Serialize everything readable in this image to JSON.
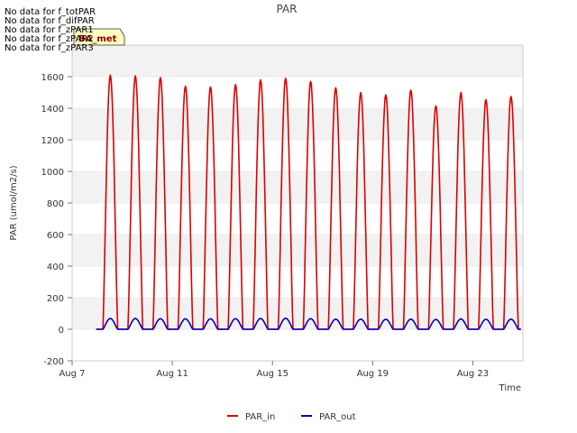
{
  "chart_data": {
    "type": "line",
    "title": "PAR",
    "xlabel": "Time",
    "ylabel": "PAR (umol/m2/s)",
    "xlim_days": [
      7,
      25
    ],
    "ylim": [
      -200,
      1800
    ],
    "yticks": [
      -200,
      0,
      200,
      400,
      600,
      800,
      1000,
      1200,
      1400,
      1600
    ],
    "xticks": [
      {
        "day": 7,
        "label": "Aug 7"
      },
      {
        "day": 11,
        "label": "Aug 11"
      },
      {
        "day": 15,
        "label": "Aug 15"
      },
      {
        "day": 19,
        "label": "Aug 19"
      },
      {
        "day": 23,
        "label": "Aug 23"
      }
    ],
    "grid": "horizontal bands",
    "legend_position": "bottom-center",
    "no_data_messages": [
      "No data for f_totPAR",
      "No data for f_difPAR",
      "No data for f_zPAR1",
      "No data for f_zPAR2",
      "No data for f_zPAR3"
    ],
    "badge": "BA_met",
    "series": [
      {
        "name": "PAR_in",
        "color": "#dd0000",
        "daily_peaks": [
          {
            "date": "Aug 8",
            "peak": 1610
          },
          {
            "date": "Aug 9",
            "peak": 1605
          },
          {
            "date": "Aug 10",
            "peak": 1595
          },
          {
            "date": "Aug 11",
            "peak": 1540
          },
          {
            "date": "Aug 12",
            "peak": 1535
          },
          {
            "date": "Aug 13",
            "peak": 1550
          },
          {
            "date": "Aug 14",
            "peak": 1580
          },
          {
            "date": "Aug 15",
            "peak": 1590
          },
          {
            "date": "Aug 16",
            "peak": 1570
          },
          {
            "date": "Aug 17",
            "peak": 1530
          },
          {
            "date": "Aug 18",
            "peak": 1500
          },
          {
            "date": "Aug 19",
            "peak": 1485
          },
          {
            "date": "Aug 20",
            "peak": 1515
          },
          {
            "date": "Aug 21",
            "peak": 1415
          },
          {
            "date": "Aug 22",
            "peak": 1500
          },
          {
            "date": "Aug 23",
            "peak": 1455
          },
          {
            "date": "Aug 24",
            "peak": 1475
          }
        ]
      },
      {
        "name": "PAR_out",
        "color": "#0000cc",
        "daily_peaks": [
          {
            "date": "Aug 8",
            "peak": 68
          },
          {
            "date": "Aug 9",
            "peak": 68
          },
          {
            "date": "Aug 10",
            "peak": 67
          },
          {
            "date": "Aug 11",
            "peak": 66
          },
          {
            "date": "Aug 12",
            "peak": 66
          },
          {
            "date": "Aug 13",
            "peak": 67
          },
          {
            "date": "Aug 14",
            "peak": 68
          },
          {
            "date": "Aug 15",
            "peak": 70
          },
          {
            "date": "Aug 16",
            "peak": 67
          },
          {
            "date": "Aug 17",
            "peak": 64
          },
          {
            "date": "Aug 18",
            "peak": 64
          },
          {
            "date": "Aug 19",
            "peak": 63
          },
          {
            "date": "Aug 20",
            "peak": 64
          },
          {
            "date": "Aug 21",
            "peak": 62
          },
          {
            "date": "Aug 22",
            "peak": 65
          },
          {
            "date": "Aug 23",
            "peak": 63
          },
          {
            "date": "Aug 24",
            "peak": 64
          }
        ]
      }
    ]
  }
}
